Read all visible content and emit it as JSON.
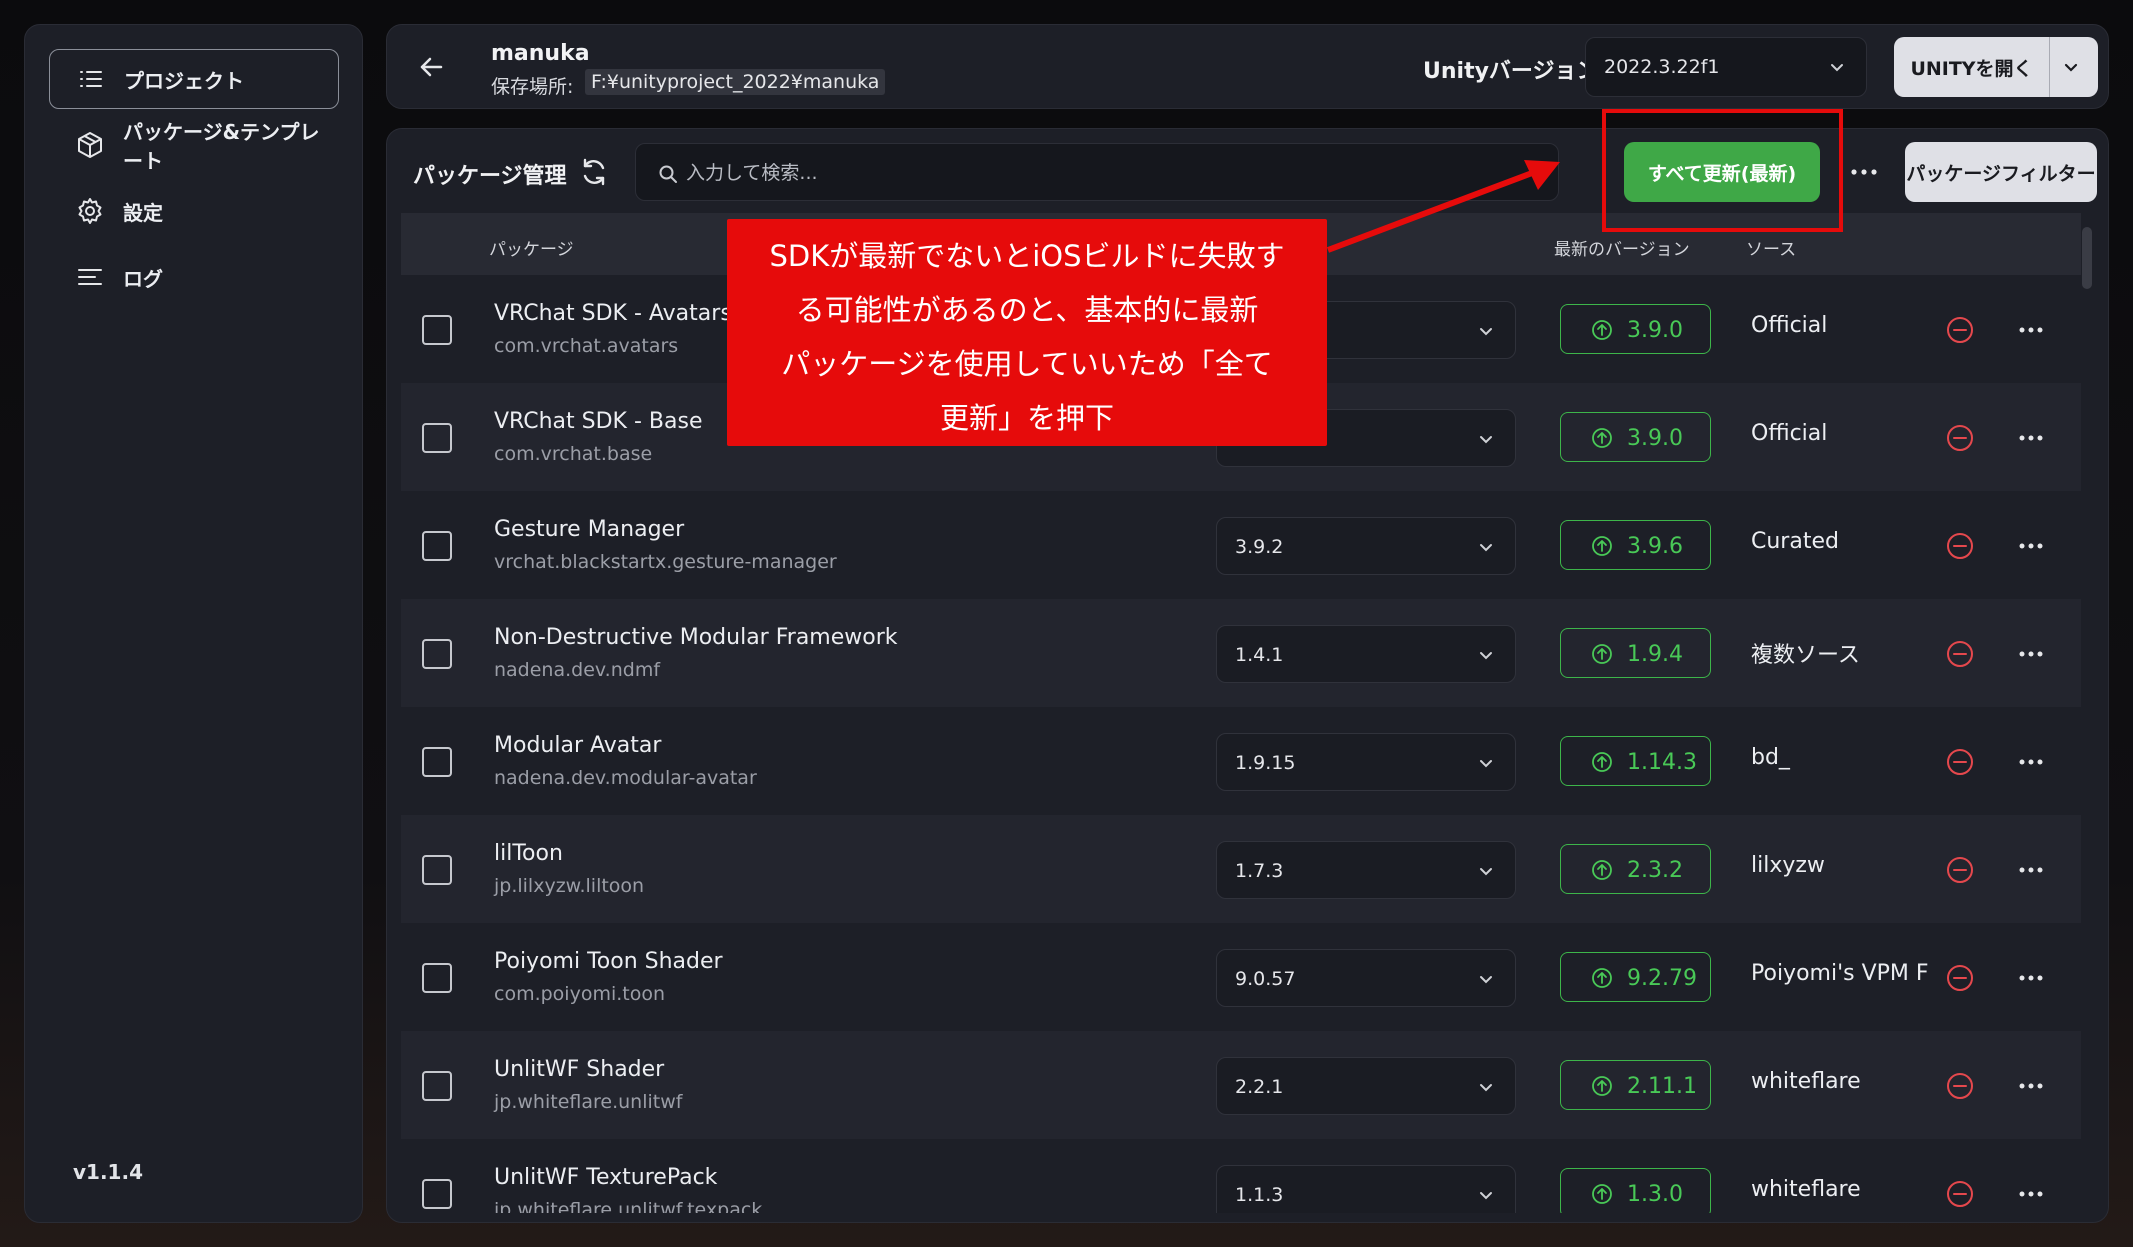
{
  "sidebar": {
    "items": [
      {
        "label": "プロジェクト",
        "icon": "list-icon",
        "active": true
      },
      {
        "label": "パッケージ&テンプレート",
        "icon": "package-icon",
        "active": false
      },
      {
        "label": "設定",
        "icon": "gear-icon",
        "active": false
      },
      {
        "label": "ログ",
        "icon": "log-icon",
        "active": false
      }
    ],
    "version": "v1.1.4"
  },
  "header": {
    "project_name": "manuka",
    "path_label": "保存場所:",
    "path": "F:¥unityproject_2022¥manuka",
    "unity_label": "Unityバージョン:",
    "unity_version": "2022.3.22f1",
    "open_button": "UNITYを開く"
  },
  "panel": {
    "title": "パッケージ管理",
    "search_placeholder": "入力して検索...",
    "update_all": "すべて更新(最新)",
    "filter_button": "パッケージフィルター"
  },
  "table": {
    "headers": {
      "package": "パッケージ",
      "latest": "最新のバージョン",
      "source": "ソース"
    },
    "rows": [
      {
        "name": "VRChat SDK - Avatars",
        "id": "com.vrchat.avatars",
        "installed": "",
        "latest": "3.9.0",
        "source": "Official"
      },
      {
        "name": "VRChat SDK - Base",
        "id": "com.vrchat.base",
        "installed": "",
        "latest": "3.9.0",
        "source": "Official"
      },
      {
        "name": "Gesture Manager",
        "id": "vrchat.blackstartx.gesture-manager",
        "installed": "3.9.2",
        "latest": "3.9.6",
        "source": "Curated"
      },
      {
        "name": "Non-Destructive Modular Framework",
        "id": "nadena.dev.ndmf",
        "installed": "1.4.1",
        "latest": "1.9.4",
        "source": "複数ソース"
      },
      {
        "name": "Modular Avatar",
        "id": "nadena.dev.modular-avatar",
        "installed": "1.9.15",
        "latest": "1.14.3",
        "source": "bd_"
      },
      {
        "name": "lilToon",
        "id": "jp.lilxyzw.liltoon",
        "installed": "1.7.3",
        "latest": "2.3.2",
        "source": "lilxyzw"
      },
      {
        "name": "Poiyomi Toon Shader",
        "id": "com.poiyomi.toon",
        "installed": "9.0.57",
        "latest": "9.2.79",
        "source": "Poiyomi's VPM F"
      },
      {
        "name": "UnlitWF Shader",
        "id": "jp.whiteflare.unlitwf",
        "installed": "2.2.1",
        "latest": "2.11.1",
        "source": "whiteflare"
      },
      {
        "name": "UnlitWF TexturePack",
        "id": "jp.whiteflare.unlitwf.texpack",
        "installed": "1.1.3",
        "latest": "1.3.0",
        "source": "whiteflare"
      }
    ]
  },
  "annotation": {
    "lines": [
      "SDKが最新でないとiOSビルドに失敗す",
      "る可能性があるのと、基本的に最新",
      "パッケージを使用していいため「全て",
      "更新」を押下"
    ]
  },
  "colors": {
    "accent_green": "#3fa847",
    "annotation_red": "#e60b0b",
    "remove_red": "#e5484d"
  }
}
